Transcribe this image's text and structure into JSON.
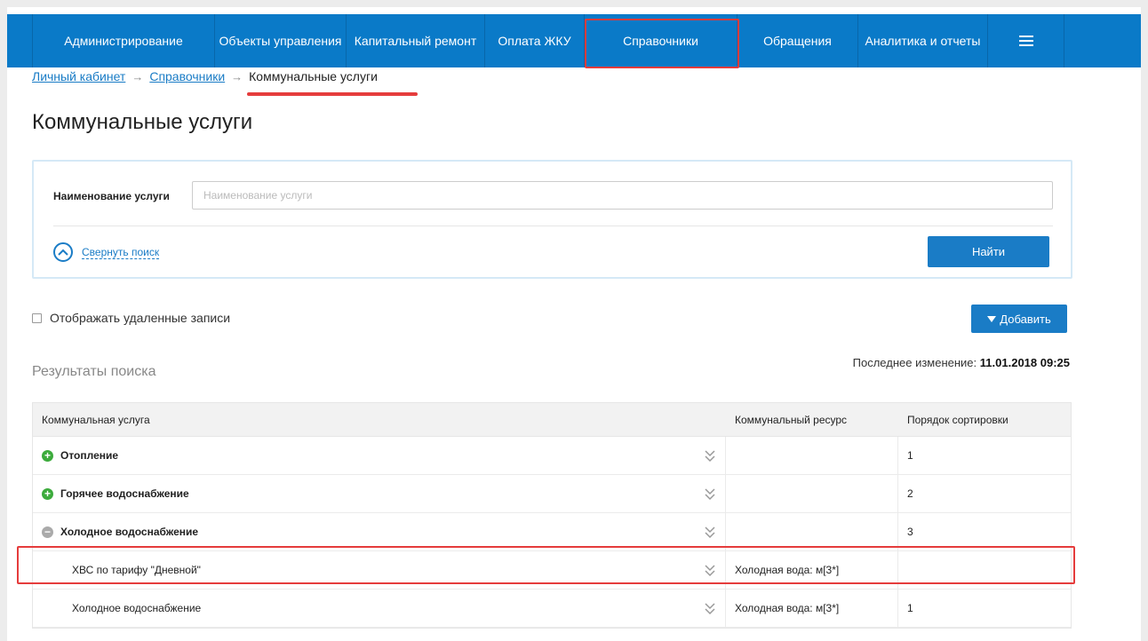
{
  "nav": {
    "items": [
      {
        "label": "Администрирование"
      },
      {
        "label": "Объекты управления"
      },
      {
        "label": "Капитальный ремонт"
      },
      {
        "label": "Оплата ЖКУ"
      },
      {
        "label": "Справочники"
      },
      {
        "label": "Обращения"
      },
      {
        "label": "Аналитика и отчеты"
      }
    ],
    "menu_icon": "hamburger-icon"
  },
  "breadcrumb": {
    "items": [
      "Личный кабинет",
      "Справочники"
    ],
    "current": "Коммунальные услуги",
    "separator": "→"
  },
  "page_title": "Коммунальные услуги",
  "search": {
    "label": "Наименование услуги",
    "placeholder": "Наименование услуги",
    "value": "",
    "collapse_label": "Свернуть поиск",
    "find_button": "Найти"
  },
  "show_deleted": {
    "label": "Отображать удаленные записи",
    "checked": false
  },
  "add_button": "Добавить",
  "results_title": "Результаты поиска",
  "last_change": {
    "label": "Последнее изменение:",
    "value": "11.01.2018 09:25"
  },
  "table": {
    "headers": [
      "Коммунальная услуга",
      "Коммунальный ресурс",
      "Порядок сортировки"
    ],
    "rows": [
      {
        "service": "Отопление",
        "resource": "",
        "order": "1",
        "level": "parent",
        "state": "collapsed"
      },
      {
        "service": "Горячее водоснабжение",
        "resource": "",
        "order": "2",
        "level": "parent",
        "state": "collapsed"
      },
      {
        "service": "Холодное водоснабжение",
        "resource": "",
        "order": "3",
        "level": "parent",
        "state": "expanded"
      },
      {
        "service": "ХВС по тарифу \"Дневной\"",
        "resource": "Холодная вода: м[3*]",
        "order": "",
        "level": "child",
        "highlighted": true
      },
      {
        "service": "Холодное водоснабжение",
        "resource": "Холодная вода: м[3*]",
        "order": "1",
        "level": "child"
      }
    ]
  },
  "colors": {
    "nav_bg": "#0a7ac8",
    "accent": "#1a7cc6",
    "highlight": "#e53c3c",
    "plus": "#3cab3c"
  }
}
